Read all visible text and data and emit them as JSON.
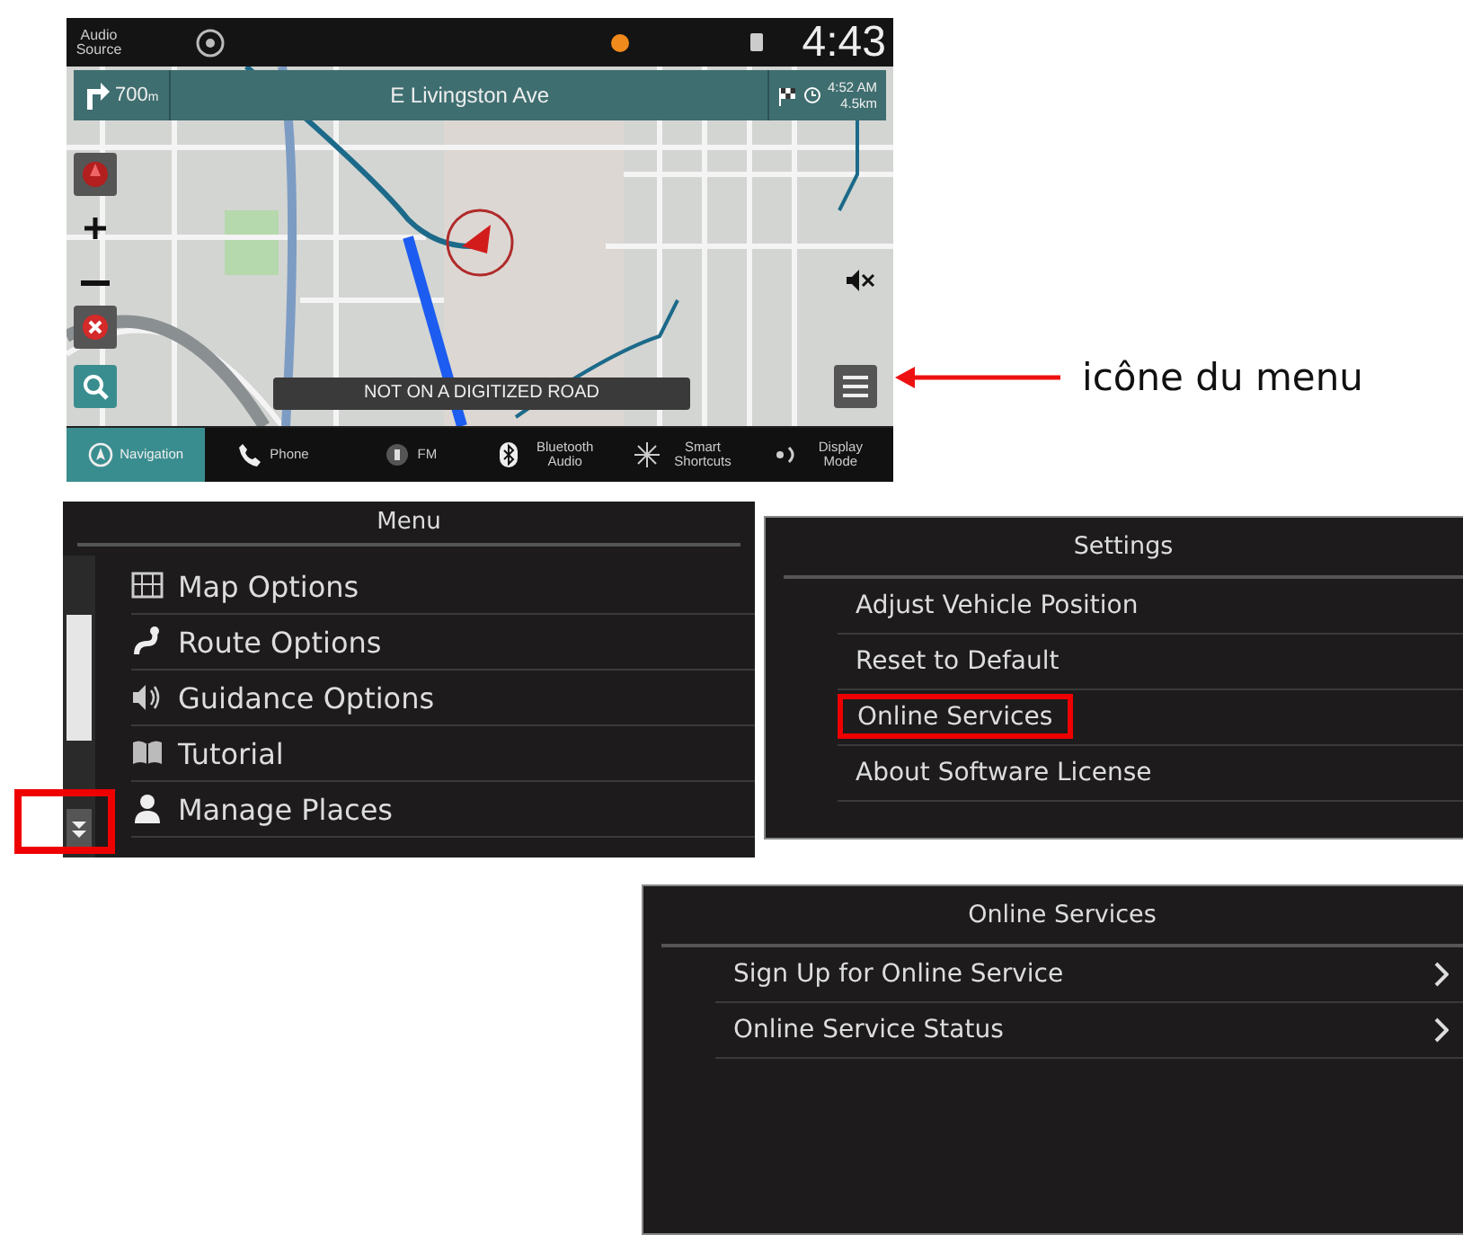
{
  "nav_screen": {
    "status_bar": {
      "audio_source": "Audio Source",
      "clock": "4:43"
    },
    "guidance": {
      "distance": "700",
      "distance_unit": "m",
      "street": "E Livingston Ave",
      "arrival_time": "4:52 AM",
      "remaining": "4.5km"
    },
    "map_message": "NOT ON A DIGITIZED ROAD",
    "bottom_tabs": [
      {
        "label": "Navigation",
        "kind": "navigation",
        "selected": true
      },
      {
        "label": "Phone",
        "kind": "phone",
        "selected": false
      },
      {
        "label": "FM",
        "kind": "radio",
        "selected": false
      },
      {
        "label": "Bluetooth Audio",
        "kind": "bluetooth",
        "selected": false
      },
      {
        "label": "Smart Shortcuts",
        "kind": "shortcuts",
        "selected": false
      },
      {
        "label": "Display Mode",
        "kind": "display",
        "selected": false
      }
    ]
  },
  "callout": {
    "label": "icône du menu"
  },
  "menu": {
    "title": "Menu",
    "scroll_down_highlighted": true,
    "items": [
      {
        "label": "Map Options",
        "kind": "map"
      },
      {
        "label": "Route Options",
        "kind": "route"
      },
      {
        "label": "Guidance Options",
        "kind": "sound"
      },
      {
        "label": "Tutorial",
        "kind": "book"
      },
      {
        "label": "Manage Places",
        "kind": "person"
      }
    ]
  },
  "settings": {
    "title": "Settings",
    "items": [
      {
        "label": "Adjust Vehicle Position",
        "highlighted": false
      },
      {
        "label": "Reset to Default",
        "highlighted": false
      },
      {
        "label": "Online Services",
        "highlighted": true
      },
      {
        "label": "About Software License",
        "highlighted": false
      }
    ]
  },
  "online_services": {
    "title": "Online Services",
    "items": [
      {
        "label": "Sign Up for Online Service"
      },
      {
        "label": "Online Service Status"
      }
    ]
  }
}
